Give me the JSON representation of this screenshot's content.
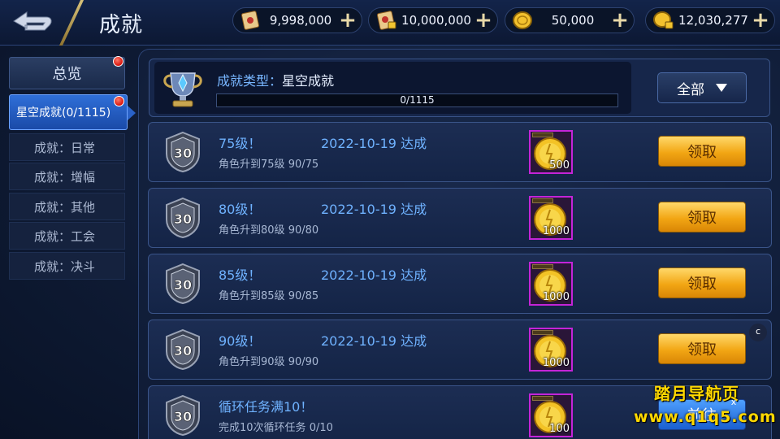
{
  "header": {
    "title": "成就",
    "resources": [
      {
        "icon": "scroll-icon",
        "value": "9,998,000"
      },
      {
        "icon": "locked-scroll-icon",
        "value": "10,000,000"
      },
      {
        "icon": "gold-coin-icon",
        "value": "50,000"
      },
      {
        "icon": "locked-coin-icon",
        "value": "12,030,277"
      }
    ]
  },
  "sidebar": {
    "overview": "总览",
    "active": "星空成就(0/1115)",
    "items": [
      "成就：日常",
      "成就：增幅",
      "成就：其他",
      "成就：工会",
      "成就：决斗"
    ]
  },
  "summary": {
    "type_label": "成就类型：",
    "type_value": "星空成就",
    "progress_text": "0/1115",
    "progress": 0,
    "filter_label": "全部"
  },
  "achievements": [
    {
      "title": "75级！",
      "date": "2022-10-19 达成",
      "desc": "角色升到75级",
      "progress": "90/75",
      "reward_qty": "500",
      "action": "领取",
      "badge": "30"
    },
    {
      "title": "80级！",
      "date": "2022-10-19 达成",
      "desc": "角色升到80级",
      "progress": "90/80",
      "reward_qty": "1000",
      "action": "领取",
      "badge": "30"
    },
    {
      "title": "85级！",
      "date": "2022-10-19 达成",
      "desc": "角色升到85级",
      "progress": "90/85",
      "reward_qty": "1000",
      "action": "领取",
      "badge": "30"
    },
    {
      "title": "90级！",
      "date": "2022-10-19 达成",
      "desc": "角色升到90级",
      "progress": "90/90",
      "reward_qty": "1000",
      "action": "领取",
      "badge": "30"
    },
    {
      "title": "循环任务满10！",
      "date": "",
      "desc": "完成10次循环任务",
      "progress": "0/10",
      "reward_qty": "100",
      "action": "前往",
      "badge": "30"
    }
  ],
  "side_marker": "c",
  "watermark": {
    "title": "踏月导航页",
    "url": "www.q1q5.com",
    "close": "x"
  },
  "colors": {
    "accent_blue": "#6fb2ff",
    "claim_gold": "#f2a614",
    "highlight": "#2f6fd8"
  }
}
